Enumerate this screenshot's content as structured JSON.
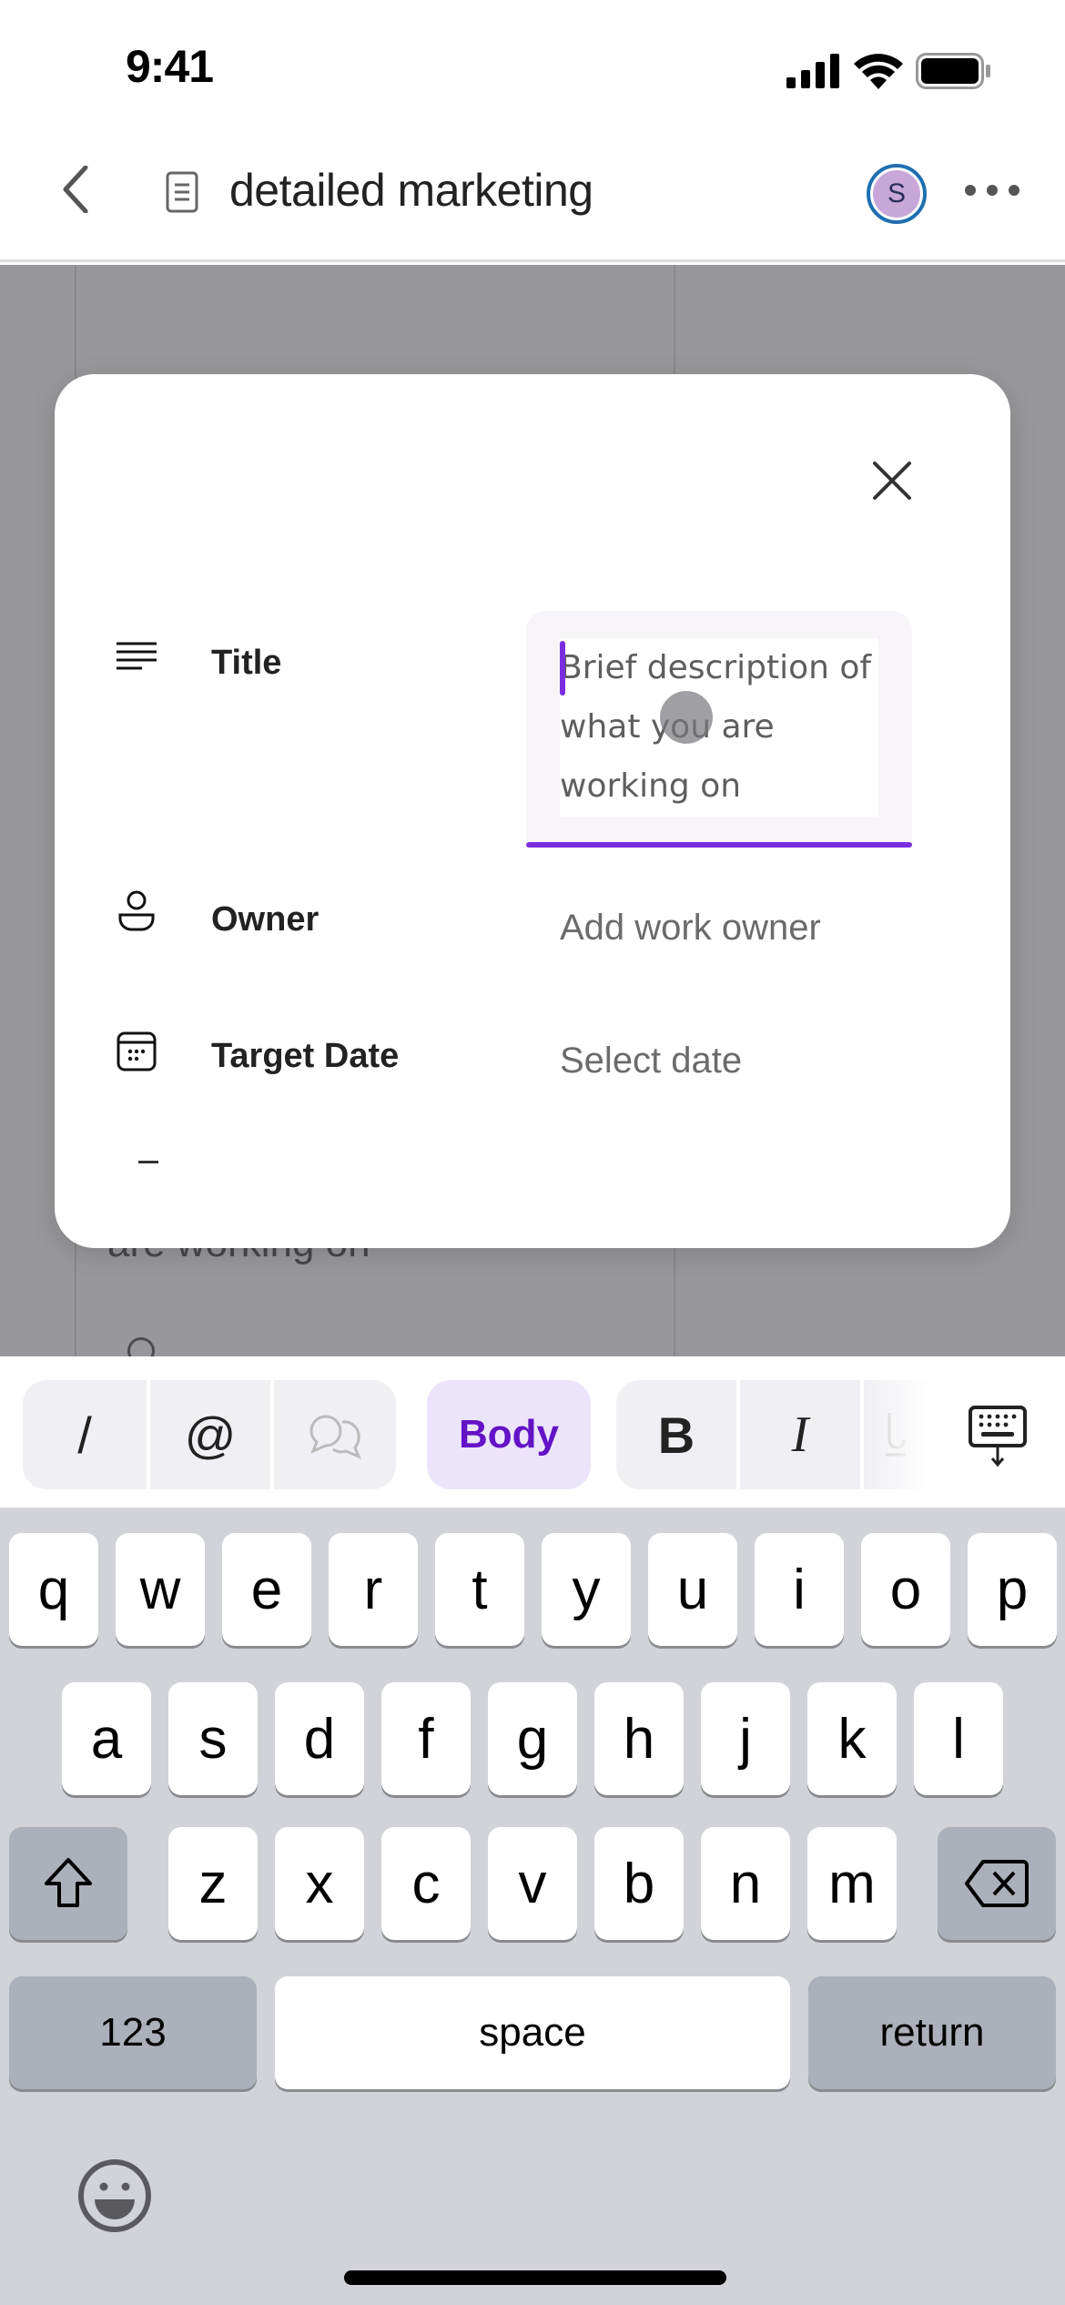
{
  "status_bar": {
    "time": "9:41",
    "icons": [
      "cellular-signal-icon",
      "wifi-icon",
      "battery-icon"
    ]
  },
  "header": {
    "back_icon": "chevron-left-icon",
    "doc_icon": "document-icon",
    "title": "detailed marketing",
    "avatar_initial": "S",
    "more_icon": "ellipsis-icon"
  },
  "background": {
    "partial_text": "are working on"
  },
  "modal": {
    "close_icon": "close-icon",
    "fields": [
      {
        "icon": "text-lines-icon",
        "label": "Title",
        "placeholder": "Brief description of what you are working on",
        "value": ""
      },
      {
        "icon": "person-icon",
        "label": "Owner",
        "value": "Add work owner"
      },
      {
        "icon": "calendar-icon",
        "label": "Target Date",
        "value": "Select date"
      }
    ],
    "accent_color": "#7b2ee0"
  },
  "toolbar": {
    "slash_label": "/",
    "mention_label": "@",
    "comment_icon": "comment-icon",
    "style_label": "Body",
    "bold_label": "B",
    "italic_label": "I",
    "underline_icon": "underline-icon",
    "dismiss_icon": "keyboard-dismiss-icon",
    "style_color": "#6412c5"
  },
  "keyboard": {
    "row1": [
      "q",
      "w",
      "e",
      "r",
      "t",
      "y",
      "u",
      "i",
      "o",
      "p"
    ],
    "row2": [
      "a",
      "s",
      "d",
      "f",
      "g",
      "h",
      "j",
      "k",
      "l"
    ],
    "row3": [
      "z",
      "x",
      "c",
      "v",
      "b",
      "n",
      "m"
    ],
    "numbers_label": "123",
    "space_label": "space",
    "return_label": "return",
    "shift_icon": "shift-icon",
    "delete_icon": "backspace-icon",
    "emoji_icon": "emoji-icon"
  }
}
